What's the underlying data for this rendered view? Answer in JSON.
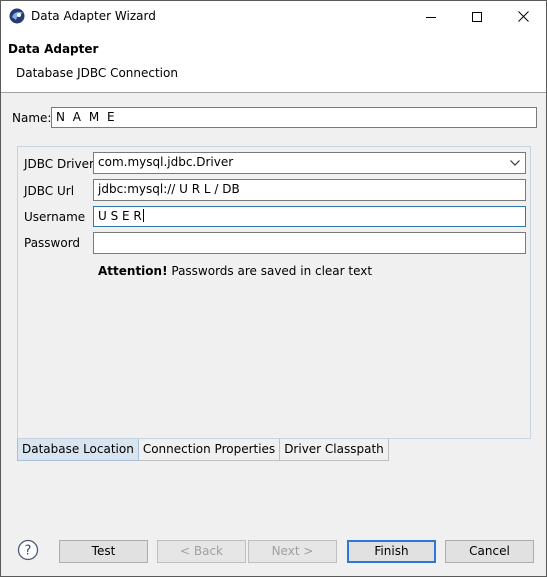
{
  "window": {
    "title": "Data Adapter Wizard"
  },
  "header": {
    "title": "Data Adapter",
    "subtitle": "Database JDBC Connection"
  },
  "name_field": {
    "label": "Name:",
    "value": "N A M E"
  },
  "connection": {
    "driver_label": "JDBC Driver",
    "driver_value": "com.mysql.jdbc.Driver",
    "url_label": "JDBC Url",
    "url_value": "jdbc:mysql:// U R L / DB",
    "username_label": "Username",
    "username_value": "U S E R",
    "password_label": "Password",
    "password_value": "",
    "attention_bold": "Attention!",
    "attention_text": " Passwords are saved in clear text"
  },
  "tabs": [
    {
      "label": "Database Location",
      "active": true
    },
    {
      "label": "Connection Properties",
      "active": false
    },
    {
      "label": "Driver Classpath",
      "active": false
    }
  ],
  "buttons": {
    "test": "Test",
    "back": "< Back",
    "next": "Next >",
    "finish": "Finish",
    "cancel": "Cancel"
  },
  "icons": {
    "app": "eclipse-icon",
    "help": "help-icon",
    "minimize": "minimize-icon",
    "maximize": "maximize-icon",
    "close": "close-icon",
    "dropdown": "chevron-down-icon"
  },
  "colors": {
    "focus_border": "#2e7aa5",
    "active_tab": "#d8e4f0",
    "default_button_border": "#2a79d6"
  }
}
